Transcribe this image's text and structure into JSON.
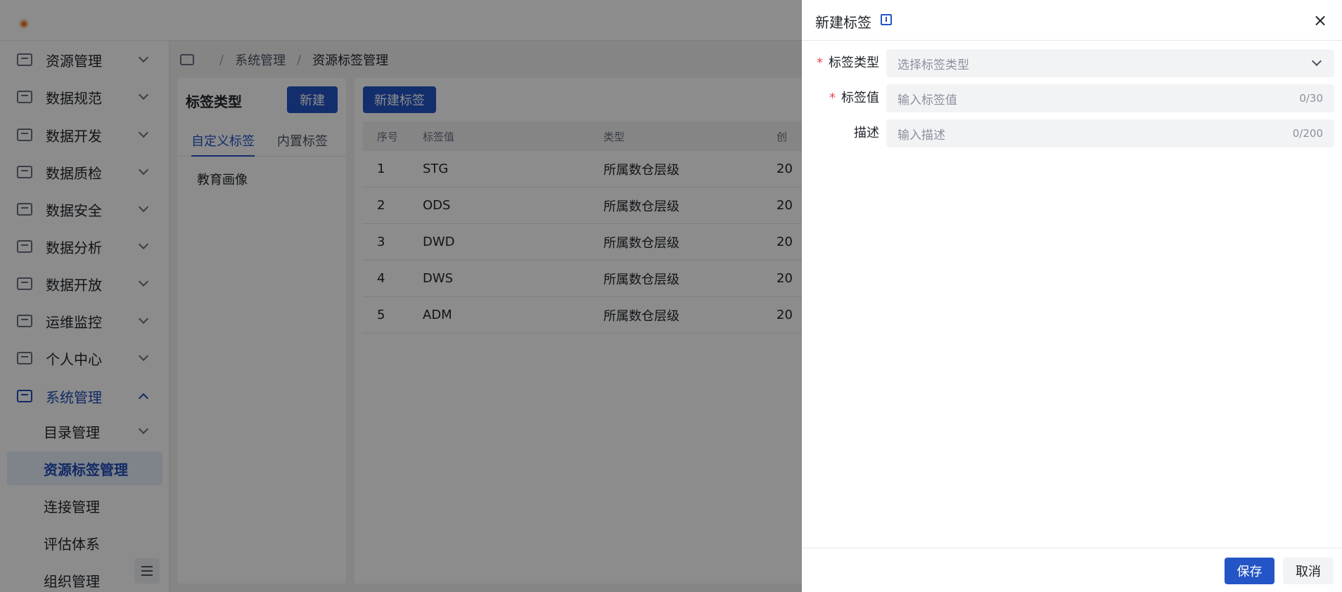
{
  "sidebar": {
    "items": [
      {
        "label": "资源管理",
        "icon": "resource-icon"
      },
      {
        "label": "数据规范",
        "icon": "standard-icon"
      },
      {
        "label": "数据开发",
        "icon": "develop-icon"
      },
      {
        "label": "数据质检",
        "icon": "quality-icon"
      },
      {
        "label": "数据安全",
        "icon": "security-icon"
      },
      {
        "label": "数据分析",
        "icon": "analysis-icon"
      },
      {
        "label": "数据开放",
        "icon": "open-icon"
      },
      {
        "label": "运维监控",
        "icon": "monitor-icon"
      },
      {
        "label": "个人中心",
        "icon": "user-icon"
      },
      {
        "label": "系统管理",
        "icon": "system-icon"
      }
    ],
    "sub_items": [
      {
        "label": "目录管理"
      },
      {
        "label": "资源标签管理"
      },
      {
        "label": "连接管理"
      },
      {
        "label": "评估体系"
      },
      {
        "label": "组织管理"
      }
    ]
  },
  "breadcrumb": {
    "sep1": "/",
    "item1": "系统管理",
    "sep2": "/",
    "item2": "资源标签管理"
  },
  "left_panel": {
    "title": "标签类型",
    "new_button": "新建",
    "tabs": [
      "自定义标签",
      "内置标签"
    ],
    "list": [
      "教育画像"
    ]
  },
  "main": {
    "new_tag_button": "新建标签",
    "table": {
      "headers": [
        "序号",
        "标签值",
        "类型",
        "创"
      ],
      "rows": [
        [
          "1",
          "STG",
          "所属数仓层级",
          "20"
        ],
        [
          "2",
          "ODS",
          "所属数仓层级",
          "20"
        ],
        [
          "3",
          "DWD",
          "所属数仓层级",
          "20"
        ],
        [
          "4",
          "DWS",
          "所属数仓层级",
          "20"
        ],
        [
          "5",
          "ADM",
          "所属数仓层级",
          "20"
        ]
      ]
    }
  },
  "drawer": {
    "title": "新建标签",
    "close": "×",
    "fields": {
      "tag_type": {
        "label": "标签类型",
        "placeholder": "选择标签类型",
        "required": "*"
      },
      "tag_value": {
        "label": "标签值",
        "placeholder": "输入标签值",
        "count": "0/30",
        "required": "*"
      },
      "description": {
        "label": "描述",
        "placeholder": "输入描述",
        "count": "0/200"
      }
    },
    "save": "保存",
    "cancel": "取消"
  },
  "colors": {
    "primary": "#2455c6",
    "required": "#e5484d",
    "mask": "rgba(0,0,0,0.45)"
  }
}
